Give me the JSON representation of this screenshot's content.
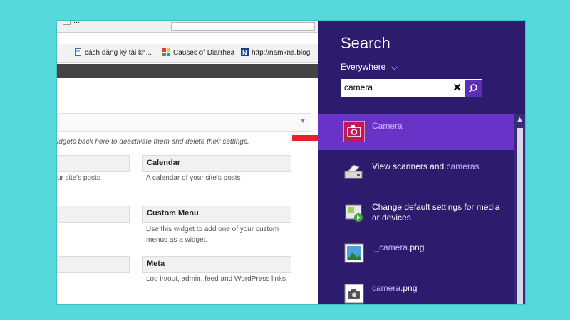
{
  "browser": {
    "tab_fragment": "...",
    "bookmarks": [
      {
        "label": "cách đăng ký tài kh...",
        "icon": "document-icon"
      },
      {
        "label": "Causes of Diarrhea",
        "icon": "colorful-grid-icon"
      },
      {
        "label": "http://namkna.blog",
        "icon": "n-site-icon"
      }
    ],
    "widgets_hint": "idgets back here to deactivate them and delete their settings.",
    "widgets": [
      {
        "title": "",
        "desc": "ur site's posts"
      },
      {
        "title": "Calendar",
        "desc": "A calendar of your site's posts"
      },
      {
        "title": "Custom Menu",
        "desc": "Use this widget to add one of your custom menus as a widget."
      },
      {
        "title": "Meta",
        "desc": "Log in/out, admin, feed and WordPress links"
      }
    ]
  },
  "search": {
    "title": "Search",
    "scope": "Everywhere",
    "query": "camera",
    "results": [
      {
        "pre": "",
        "hl": "Camera",
        "post": "",
        "icon": "camera-app-icon",
        "selected": true
      },
      {
        "pre": "View scanners and ",
        "hl": "cameras",
        "post": "",
        "icon": "scanner-icon"
      },
      {
        "pre": "Change default settings for media or devices",
        "hl": "",
        "post": "",
        "icon": "autoplay-settings-icon"
      },
      {
        "pre": "._",
        "hl": "camera",
        "post": ".png",
        "icon": "image-file-icon"
      },
      {
        "pre": "",
        "hl": "camera",
        "post": ".png",
        "icon": "image-file-icon"
      }
    ]
  },
  "colors": {
    "background": "#55d9dd",
    "search_pane": "#2d1b6e",
    "selected": "#6a33c8",
    "arrow": "#e8202a"
  }
}
